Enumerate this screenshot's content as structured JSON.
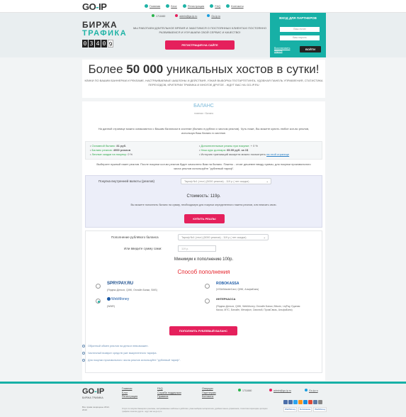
{
  "nav": {
    "logo": "GO-IP",
    "links": [
      "Главная",
      "Блог",
      "Регистрация",
      "FAQ",
      "Контакты"
    ]
  },
  "hero": {
    "brand_line1": "БИРЖА",
    "brand_line2": "ТРАФИКА",
    "counter_digits": [
      "0",
      "3",
      "4",
      "0",
      "9"
    ],
    "phone": "1711660",
    "email": "admin@go-ip.ru",
    "skype": "Go-ip.ru",
    "text": "МЫ РАБОТАЕМ ДЛИТЕЛЬНОЕ ВРЕМЯ И ЗАБОТИМСЯ О ПОСТОЯННЫХ КЛИЕНТАХ! ПОСТОЯННО РАЗВИВАЕМСЯ И УЛУЧШАЕМ СВОЙ СЕРВИС И КАЧЕСТВО!",
    "register_button": "РЕГИСТРАЦИЯ НА САЙТЕ"
  },
  "partner": {
    "title": "ВХОД ДЛЯ ПАРТНЕРОВ",
    "login_placeholder": "Ваш логин",
    "password_placeholder": "Ваш пароль",
    "forgot": "Восстановить пароль",
    "login_button": "ВОЙТИ"
  },
  "headline": {
    "prefix": "Более ",
    "bold": "50 000",
    "rest": " уникальных хостов в сутки!",
    "sub": "КЛИКИ ПО ВАШИМ БАННЕРАМ И РЕКЛАМЕ, НАСТРАИВАЕМЫЕ ШАБЛОНЫ И ДЕЙСТВИЯ, УЗКАЯ ВЫБОРКА ГЕОТАРГЕТИНГА, УДОБНАЯ ПАНЕЛЬ УПРАВЛЕНИЯ, СТАТИСТИКА ПЕРЕХОДОВ, КРИТЕРИИ ТРАФИКА И МНОГОЕ ДРУГОЕ - ЖДУТ ВАС НА GO-IP.RU"
  },
  "page": {
    "title": "БАЛАНС",
    "breadcrumb": "главная › баланс",
    "intro": "На данной странице можно ознакомится с Вашим балансом в системе (баланс в рублях и числом реалов). Чуть ниже, Вы можете купить любое кол-во реалов, используя Ваш баланс в системе.",
    "info_left": [
      {
        "label": "Основной баланс: ",
        "value": "81 руб."
      },
      {
        "label": "Баланс реалов: ",
        "value": "4900 реалов"
      },
      {
        "label": "Личные скидки на покупку: ",
        "value": "0 %"
      }
    ],
    "info_right": [
      {
        "label": "Дополнительные реалы при покупке: ",
        "value": "+ 0 %"
      },
      {
        "label": "Наш курс доллара: ",
        "value": "65.99 руб. за 1$"
      },
      {
        "label": "Историю транзакций аккаунта можно посмотреть ",
        "value": "на этой странице"
      }
    ],
    "choose": "Выберите нужный пакет реалов. После покупки кол-во реалов будет зачислено Вам на баланс. Пакеты - стоят дешевле вводу суммы, для покупки произвольного числа реалов используйте \"рублевый тариф\"."
  },
  "buy": {
    "label": "Покупка внутренней валюты (реалов)",
    "select": "Тариф №1 (тест) (5000 реалов) - 119 р ( нет скидки)",
    "cost": "Стоимость: 119р.",
    "hint": "Вы можете пополнить баланс на сумму, необходимую для покупки определенного пакета реалов, или вписать свою.",
    "button": "КУПИТЬ РЕАЛЫ"
  },
  "topup": {
    "label": "Пополнение рублёвого баланса",
    "select": "Тариф №1 (тест) (5000 реалов) - 119 р ( нет скидки)",
    "sum_label": "Или введите сумму сами:",
    "sum_placeholder": "119 р.",
    "minimum": "Минимум к пополнению 100р.",
    "method_title": "Способ пополнения",
    "methods": [
      {
        "logo": "SPRYPAY.RU",
        "desc": "(Яндекс.Деньги, QIWI, Онлайн Банки, SMS)"
      },
      {
        "logo": "ROBOKASSA",
        "desc": "(VISA/MasterCard, QIWI, АльфаБанк)"
      },
      {
        "logo": "WebMoney",
        "desc": "(WMR)"
      },
      {
        "logo": "ИНТЕРКАССА",
        "desc": "(Яндекс.Деньги, QIWI, WebMoney, Онлайн Банки, Bitcoin, LiqPay, Единая Касса, МТС, Билайн, Мегафон, Связной, ПромСвязь, АльфаБанк)"
      }
    ],
    "button": "ПОПОЛНИТЬ РУБЛЕВЫЙ БАЛАНС"
  },
  "notes": [
    "Обратный обмен реалов на деньги невозможен.",
    "Частичный возврат средств уже выкупленного тарифа.",
    "Для покупки произвольного числа реалов используйте \"рублевый тариф\"."
  ],
  "footer": {
    "logo": "GO-IP",
    "sub": "БИРЖА ТРАФИКА",
    "copyright": "Все права защищены 2012-2019",
    "col1": [
      "Главная",
      "Блог",
      "Регистрация"
    ],
    "col2": [
      "FAQ",
      "Служба поддержки",
      "Правила"
    ],
    "col3": [
      "Оперции",
      "Партнерам",
      "Контакты"
    ],
    "phone": "1711660",
    "email": "admin@go-ip.ru",
    "skype": "Go-ip.ru",
    "small": "Услуги по покупке баннеров и рекламы, настраиваемые шаблоны и действия, узкая выборка геотаргетинга, удобная панель управления, статистика переходов, критерии трафика и многое другое - ждут вас на go-ip.ru",
    "pay_logos": [
      "WebMoney",
      "Robokassa",
      "WebMoney"
    ]
  }
}
